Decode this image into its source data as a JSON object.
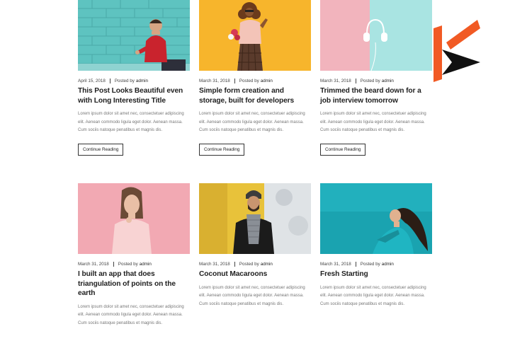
{
  "posts": [
    {
      "date": "April 15, 2018",
      "posted_by": "Posted by",
      "author": "admin",
      "title": "This Post Looks Beautiful even with Long Interesting Title",
      "excerpt": "Lorem ipsum dolor sit amet nec, consectetuer adipiscing elit. Aenean commodo ligula eget dolor. Aenean massa. Cum sociis natoque penatibus et magnis dis.",
      "button": "Continue Reading",
      "image": "man-red-sweater-brick-wall",
      "image_color": "#5ec3c0"
    },
    {
      "date": "March 31, 2018",
      "posted_by": "Posted by",
      "author": "admin",
      "title": "Simple form creation and storage, built for developers",
      "excerpt": "Lorem ipsum dolor sit amet nec, consectetuer adipiscing elit. Aenean commodo ligula eget dolor. Aenean massa. Cum sociis natoque penatibus et magnis dis.",
      "button": "Continue Reading",
      "image": "woman-yellow-background",
      "image_color": "#f7b52c"
    },
    {
      "date": "March 31, 2018",
      "posted_by": "Posted by",
      "author": "admin",
      "title": "Trimmed the beard down for a job interview tomorrow",
      "excerpt": "Lorem ipsum dolor sit amet nec, consectetuer adipiscing elit. Aenean commodo ligula eget dolor. Aenean massa. Cum sociis natoque penatibus et magnis dis.",
      "button": "Continue Reading",
      "image": "headphones-pink-teal",
      "image_color": "#a9e4e2"
    },
    {
      "date": "March 31, 2018",
      "posted_by": "Posted by",
      "author": "admin",
      "title": "I built an app that does triangulation of points on the earth",
      "excerpt": "Lorem ipsum dolor sit amet nec, consectetuer adipiscing elit. Aenean commodo ligula eget dolor. Aenean massa. Cum sociis natoque penatibus et magnis dis.",
      "image": "woman-pink-background",
      "image_color": "#f2a9b3"
    },
    {
      "date": "March 31, 2018",
      "posted_by": "Posted by",
      "author": "admin",
      "title": "Coconut Macaroons",
      "excerpt": "Lorem ipsum dolor sit amet nec, consectetuer adipiscing elit. Aenean commodo ligula eget dolor. Aenean massa. Cum sociis natoque penatibus et magnis dis.",
      "image": "man-beanie-yellow-wall",
      "image_color": "#e8c23a"
    },
    {
      "date": "March 31, 2018",
      "posted_by": "Posted by",
      "author": "admin",
      "title": "Fresh Starting",
      "excerpt": "Lorem ipsum dolor sit amet nec, consectetuer adipiscing elit. Aenean commodo ligula eget dolor. Aenean massa. Cum sociis natoque penatibus et magnis dis.",
      "image": "woman-teal-sky",
      "image_color": "#1aa3b0"
    }
  ],
  "brand": {
    "logo_icon": "brand-logo-icon",
    "colors": [
      "#f15a24",
      "#111111"
    ]
  }
}
